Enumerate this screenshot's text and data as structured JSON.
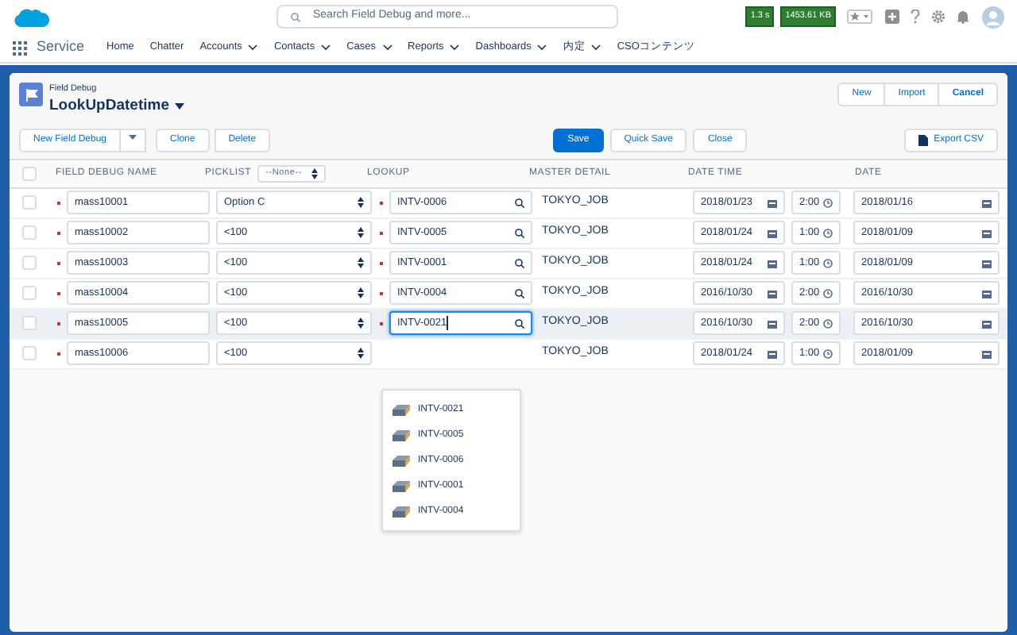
{
  "header": {
    "search_placeholder": "Search Field Debug and more...",
    "badges": [
      "1.3 s",
      "1453.61 KB"
    ]
  },
  "nav": {
    "app_name": "Service",
    "items": [
      {
        "label": "Home",
        "menu": false
      },
      {
        "label": "Chatter",
        "menu": false
      },
      {
        "label": "Accounts",
        "menu": true
      },
      {
        "label": "Contacts",
        "menu": true
      },
      {
        "label": "Cases",
        "menu": true
      },
      {
        "label": "Reports",
        "menu": true
      },
      {
        "label": "Dashboards",
        "menu": true
      },
      {
        "label": "内定",
        "menu": true
      },
      {
        "label": "CSOコンテンツ",
        "menu": false
      }
    ]
  },
  "page": {
    "object_label": "Field Debug",
    "title": "LookUpDatetime",
    "actions": [
      "New",
      "Import",
      "Cancel"
    ]
  },
  "toolbar": {
    "left": [
      "New Field Debug",
      "Clone",
      "Delete"
    ],
    "center": [
      {
        "label": "Save",
        "kind": "brand"
      },
      {
        "label": "Quick Save",
        "kind": "neutral"
      },
      {
        "label": "Close",
        "kind": "neutral"
      }
    ],
    "export": "Export CSV"
  },
  "table": {
    "columns": [
      "FIELD DEBUG NAME",
      "PICKLIST",
      "LOOKUP",
      "MASTER DETAIL",
      "DATE TIME",
      "DATE"
    ],
    "picklist_filter": "--None--",
    "select_all_checked": false,
    "rows": [
      {
        "selected": false,
        "focused": false,
        "name": "mass10001",
        "picklist": "Option C",
        "lookup": "INTV-0006",
        "master_detail": "TOKYO_JOB",
        "date_time_date": "2018/01/23",
        "date_time_time": "2:00",
        "date": "2018/01/16"
      },
      {
        "selected": false,
        "focused": false,
        "name": "mass10002",
        "picklist": "<100",
        "lookup": "INTV-0005",
        "master_detail": "TOKYO_JOB",
        "date_time_date": "2018/01/24",
        "date_time_time": "1:00",
        "date": "2018/01/09"
      },
      {
        "selected": false,
        "focused": false,
        "name": "mass10003",
        "picklist": "<100",
        "lookup": "INTV-0001",
        "master_detail": "TOKYO_JOB",
        "date_time_date": "2018/01/24",
        "date_time_time": "1:00",
        "date": "2018/01/09"
      },
      {
        "selected": false,
        "focused": false,
        "name": "mass10004",
        "picklist": "<100",
        "lookup": "INTV-0004",
        "master_detail": "TOKYO_JOB",
        "date_time_date": "2016/10/30",
        "date_time_time": "2:00",
        "date": "2016/10/30"
      },
      {
        "selected": false,
        "focused": true,
        "name": "mass10005",
        "picklist": "<100",
        "lookup": "INTV-0021",
        "master_detail": "TOKYO_JOB",
        "date_time_date": "2016/10/30",
        "date_time_time": "2:00",
        "date": "2016/10/30"
      },
      {
        "selected": false,
        "focused": false,
        "name": "mass10006",
        "picklist": "<100",
        "master_detail": "TOKYO_JOB",
        "date_time_date": "2018/01/24",
        "date_time_time": "1:00",
        "date": "2018/01/09"
      }
    ],
    "lookup_suggestions": [
      "INTV-0021",
      "INTV-0005",
      "INTV-0006",
      "INTV-0001",
      "INTV-0004"
    ]
  }
}
